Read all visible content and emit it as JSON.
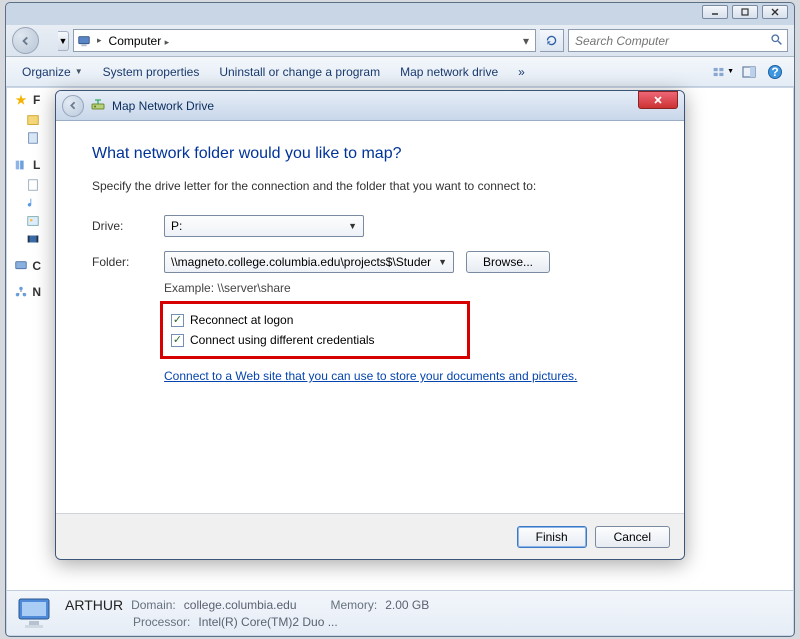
{
  "window": {
    "address_label": "Computer",
    "search_placeholder": "Search Computer"
  },
  "toolbar": {
    "organize": "Organize",
    "sysprops": "System properties",
    "uninstall": "Uninstall or change a program",
    "mapdrive": "Map network drive",
    "overflow": "»"
  },
  "sidebar": {
    "fav_hdr": "F",
    "lib_hdr": "L",
    "comp_hdr": "C",
    "net_hdr": "N"
  },
  "status": {
    "name": "ARTHUR",
    "domain_lbl": "Domain:",
    "domain_val": "college.columbia.edu",
    "mem_lbl": "Memory:",
    "mem_val": "2.00 GB",
    "proc_lbl": "Processor:",
    "proc_val": "Intel(R) Core(TM)2 Duo ..."
  },
  "dialog": {
    "title": "Map Network Drive",
    "heading": "What network folder would you like to map?",
    "instruction": "Specify the drive letter for the connection and the folder that you want to connect to:",
    "drive_lbl": "Drive:",
    "drive_val": "P:",
    "folder_lbl": "Folder:",
    "folder_val": "\\\\magneto.college.columbia.edu\\projects$\\Studer",
    "browse": "Browse...",
    "example": "Example: \\\\server\\share",
    "chk1": "Reconnect at logon",
    "chk2": "Connect using different credentials",
    "link": "Connect to a Web site that you can use to store your documents and pictures.",
    "finish": "Finish",
    "cancel": "Cancel"
  }
}
